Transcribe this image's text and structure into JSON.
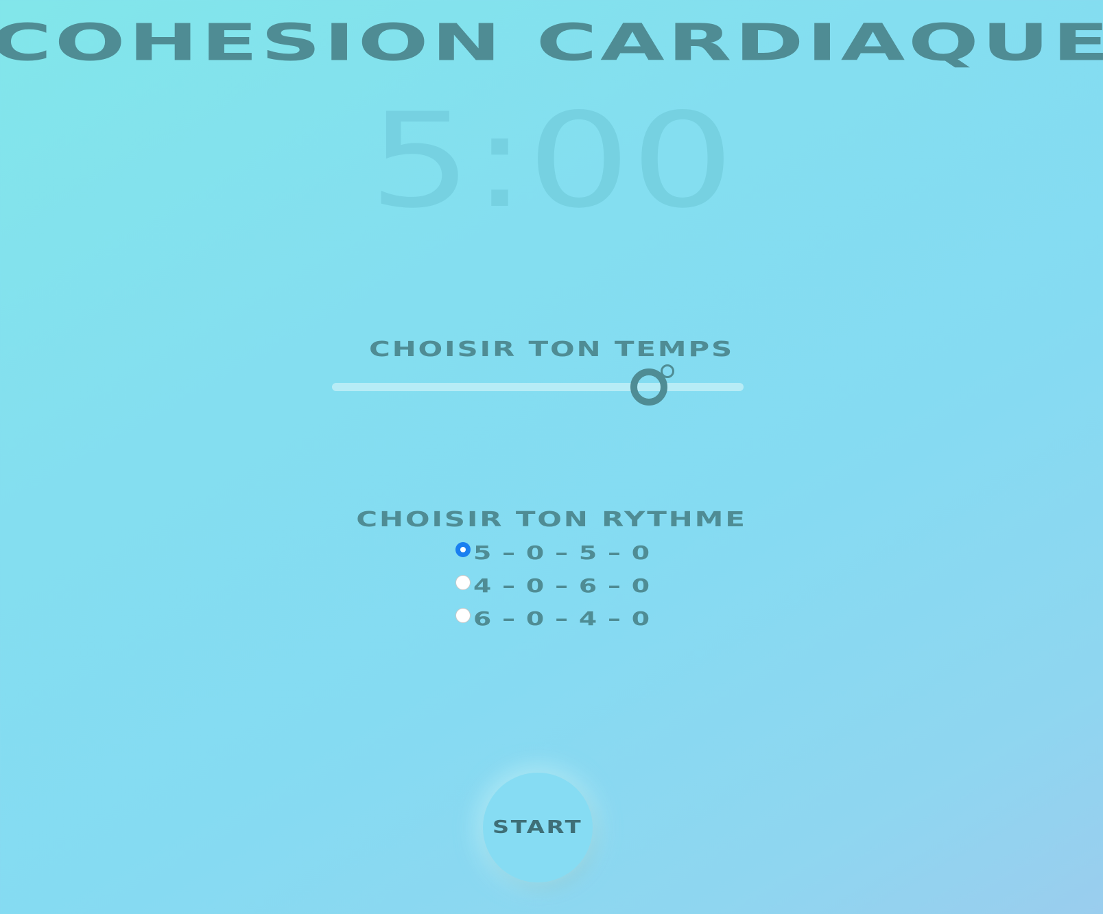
{
  "app": {
    "title": "Cohesion Cardiaque",
    "timer": "5:00"
  },
  "time_section": {
    "title": "Choisir ton temps",
    "slider_value_fraction": 0.77
  },
  "rhythm_section": {
    "title": "Choisir ton rythme",
    "options": [
      {
        "label": "5 – 0 – 5 – 0",
        "checked": true
      },
      {
        "label": "4 – 0 – 6 – 0",
        "checked": false
      },
      {
        "label": "6 – 0 – 4 – 0",
        "checked": false
      }
    ]
  },
  "start_button": {
    "label": "Start"
  },
  "colors": {
    "accent": "#4f8c94",
    "radio_selected": "#1a7ff0",
    "background_top": "#82e6ea",
    "background_bottom": "#9acdee"
  }
}
